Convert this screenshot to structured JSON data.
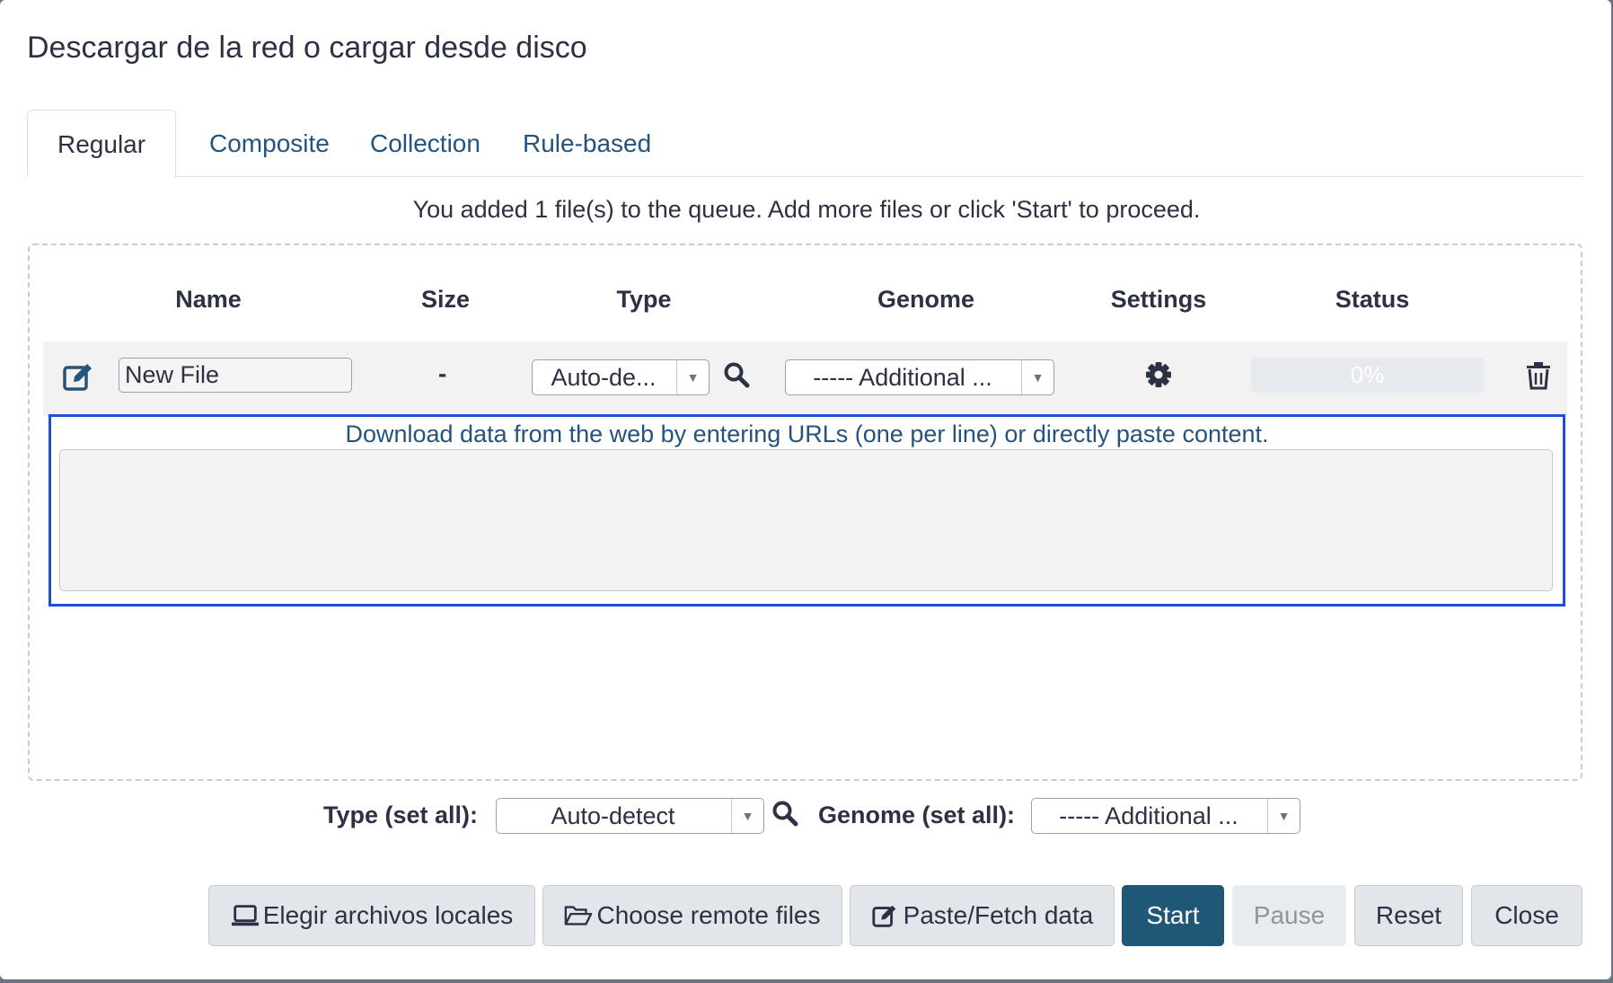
{
  "dialog": {
    "title": "Descargar de la red o cargar desde disco"
  },
  "tabs": [
    {
      "label": "Regular",
      "active": true
    },
    {
      "label": "Composite",
      "active": false
    },
    {
      "label": "Collection",
      "active": false
    },
    {
      "label": "Rule-based",
      "active": false
    }
  ],
  "queue_message": "You added 1 file(s) to the queue. Add more files or click 'Start' to proceed.",
  "table": {
    "columns": [
      "Name",
      "Size",
      "Type",
      "Genome",
      "Settings",
      "Status"
    ]
  },
  "file_row": {
    "name": "New File",
    "size": "-",
    "type": "Auto-de...",
    "genome": "----- Additional ...",
    "progress_text": "0%",
    "progress_fraction": 0,
    "icons": [
      "edit-icon",
      "search-icon",
      "gear-icon",
      "trash-icon"
    ]
  },
  "paste": {
    "hint": "Download data from the web by entering URLs (one per line) or directly paste content.",
    "content": ""
  },
  "set_all": {
    "type_label": "Type (set all):",
    "type_value": "Auto-detect",
    "genome_label": "Genome (set all):",
    "genome_value": "----- Additional ..."
  },
  "buttons": {
    "local_files": "Elegir archivos locales",
    "remote_files": "Choose remote files",
    "paste_fetch": "Paste/Fetch data",
    "start": "Start",
    "pause": "Pause",
    "reset": "Reset",
    "close": "Close"
  },
  "colors": {
    "primary": "#1f5777",
    "link": "#25537b",
    "focus_border": "#1c4fd8"
  }
}
